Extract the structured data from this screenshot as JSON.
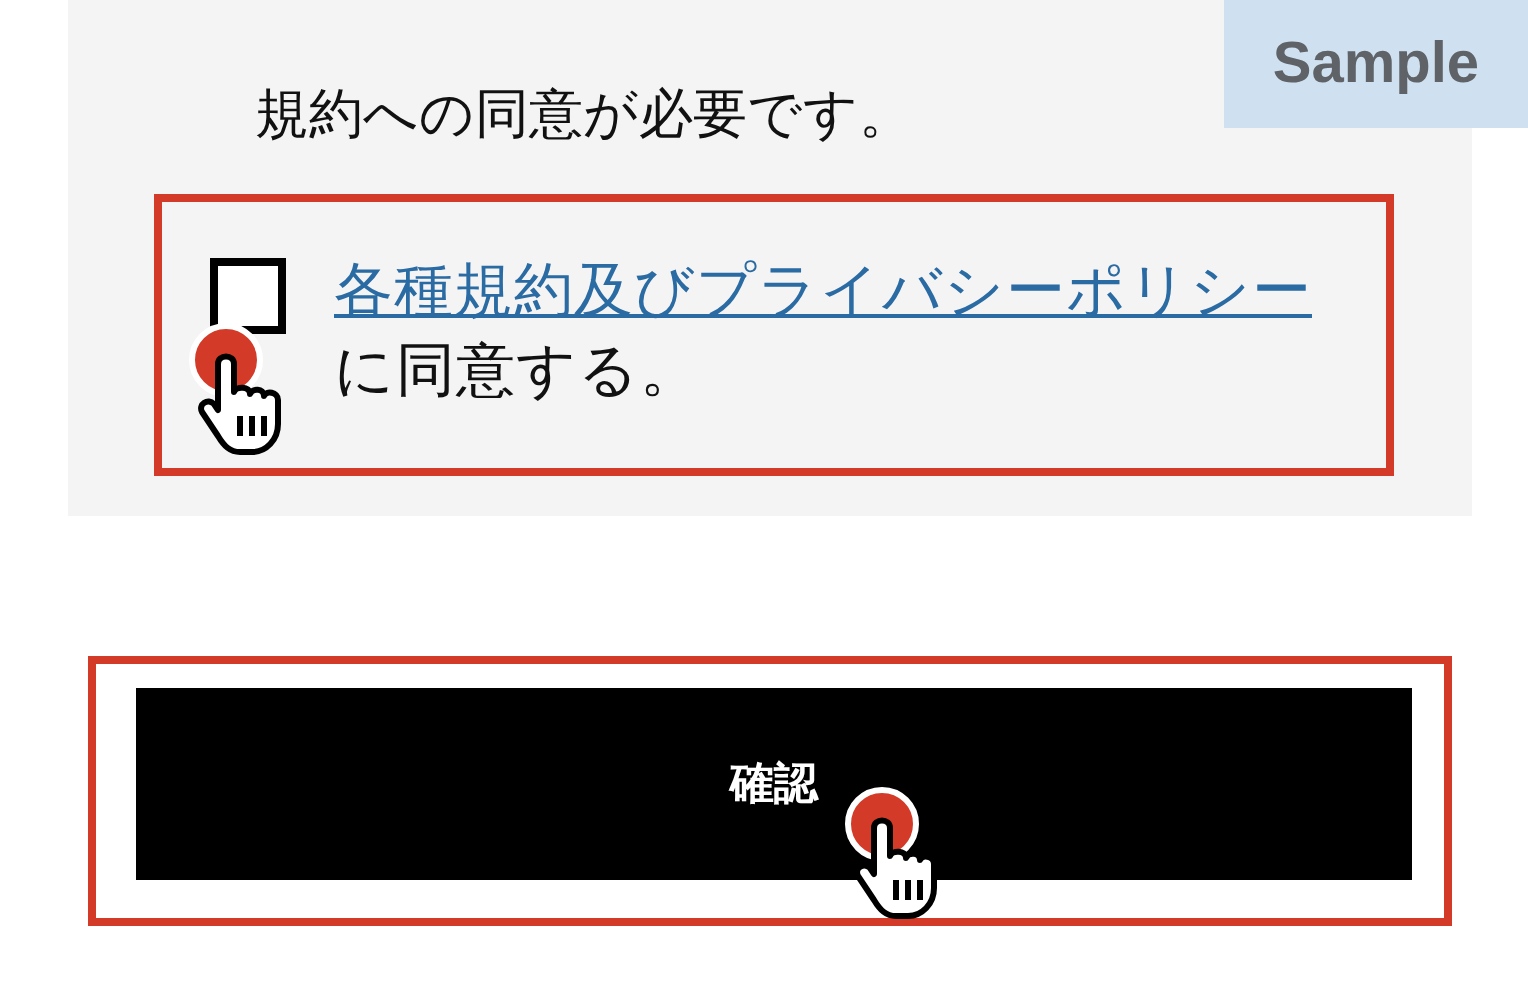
{
  "badge": "Sample",
  "notice": "規約への同意が必要です。",
  "consent": {
    "checked": false,
    "link": "各種規約及びプライバシーポリシー",
    "text_after": "に同意する。"
  },
  "confirm_button": "確認"
}
